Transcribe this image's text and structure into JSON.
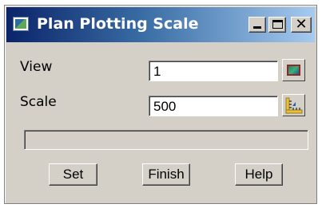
{
  "window": {
    "title": "Plan Plotting Scale",
    "title_colors": [
      "#0a246a",
      "#a6caf0"
    ],
    "face_color": "#d4d0c8"
  },
  "titlebar_buttons": {
    "minimize_icon": "minimize-icon",
    "maximize_icon": "maximize-icon",
    "close_label": "✕"
  },
  "form": {
    "view": {
      "label": "View",
      "value": "1",
      "button_icon": "view-picker-icon"
    },
    "scale": {
      "label": "Scale",
      "value": "500",
      "button_icon": "scale-picker-icon"
    }
  },
  "progress": {
    "text": ""
  },
  "buttons": {
    "set": "Set",
    "finish": "Finish",
    "help": "Help"
  }
}
